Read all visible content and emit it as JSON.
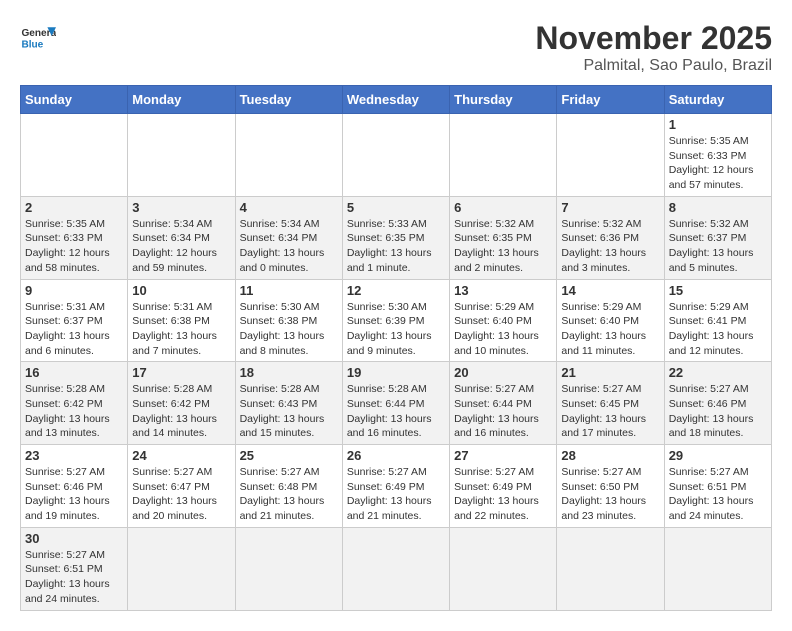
{
  "header": {
    "logo_general": "General",
    "logo_blue": "Blue",
    "month": "November 2025",
    "location": "Palmital, Sao Paulo, Brazil"
  },
  "days_of_week": [
    "Sunday",
    "Monday",
    "Tuesday",
    "Wednesday",
    "Thursday",
    "Friday",
    "Saturday"
  ],
  "weeks": [
    [
      {
        "day": "",
        "info": ""
      },
      {
        "day": "",
        "info": ""
      },
      {
        "day": "",
        "info": ""
      },
      {
        "day": "",
        "info": ""
      },
      {
        "day": "",
        "info": ""
      },
      {
        "day": "",
        "info": ""
      },
      {
        "day": "1",
        "info": "Sunrise: 5:35 AM\nSunset: 6:33 PM\nDaylight: 12 hours and 57 minutes."
      }
    ],
    [
      {
        "day": "2",
        "info": "Sunrise: 5:35 AM\nSunset: 6:33 PM\nDaylight: 12 hours and 58 minutes."
      },
      {
        "day": "3",
        "info": "Sunrise: 5:34 AM\nSunset: 6:34 PM\nDaylight: 12 hours and 59 minutes."
      },
      {
        "day": "4",
        "info": "Sunrise: 5:34 AM\nSunset: 6:34 PM\nDaylight: 13 hours and 0 minutes."
      },
      {
        "day": "5",
        "info": "Sunrise: 5:33 AM\nSunset: 6:35 PM\nDaylight: 13 hours and 1 minute."
      },
      {
        "day": "6",
        "info": "Sunrise: 5:32 AM\nSunset: 6:35 PM\nDaylight: 13 hours and 2 minutes."
      },
      {
        "day": "7",
        "info": "Sunrise: 5:32 AM\nSunset: 6:36 PM\nDaylight: 13 hours and 3 minutes."
      },
      {
        "day": "8",
        "info": "Sunrise: 5:32 AM\nSunset: 6:37 PM\nDaylight: 13 hours and 5 minutes."
      }
    ],
    [
      {
        "day": "9",
        "info": "Sunrise: 5:31 AM\nSunset: 6:37 PM\nDaylight: 13 hours and 6 minutes."
      },
      {
        "day": "10",
        "info": "Sunrise: 5:31 AM\nSunset: 6:38 PM\nDaylight: 13 hours and 7 minutes."
      },
      {
        "day": "11",
        "info": "Sunrise: 5:30 AM\nSunset: 6:38 PM\nDaylight: 13 hours and 8 minutes."
      },
      {
        "day": "12",
        "info": "Sunrise: 5:30 AM\nSunset: 6:39 PM\nDaylight: 13 hours and 9 minutes."
      },
      {
        "day": "13",
        "info": "Sunrise: 5:29 AM\nSunset: 6:40 PM\nDaylight: 13 hours and 10 minutes."
      },
      {
        "day": "14",
        "info": "Sunrise: 5:29 AM\nSunset: 6:40 PM\nDaylight: 13 hours and 11 minutes."
      },
      {
        "day": "15",
        "info": "Sunrise: 5:29 AM\nSunset: 6:41 PM\nDaylight: 13 hours and 12 minutes."
      }
    ],
    [
      {
        "day": "16",
        "info": "Sunrise: 5:28 AM\nSunset: 6:42 PM\nDaylight: 13 hours and 13 minutes."
      },
      {
        "day": "17",
        "info": "Sunrise: 5:28 AM\nSunset: 6:42 PM\nDaylight: 13 hours and 14 minutes."
      },
      {
        "day": "18",
        "info": "Sunrise: 5:28 AM\nSunset: 6:43 PM\nDaylight: 13 hours and 15 minutes."
      },
      {
        "day": "19",
        "info": "Sunrise: 5:28 AM\nSunset: 6:44 PM\nDaylight: 13 hours and 16 minutes."
      },
      {
        "day": "20",
        "info": "Sunrise: 5:27 AM\nSunset: 6:44 PM\nDaylight: 13 hours and 16 minutes."
      },
      {
        "day": "21",
        "info": "Sunrise: 5:27 AM\nSunset: 6:45 PM\nDaylight: 13 hours and 17 minutes."
      },
      {
        "day": "22",
        "info": "Sunrise: 5:27 AM\nSunset: 6:46 PM\nDaylight: 13 hours and 18 minutes."
      }
    ],
    [
      {
        "day": "23",
        "info": "Sunrise: 5:27 AM\nSunset: 6:46 PM\nDaylight: 13 hours and 19 minutes."
      },
      {
        "day": "24",
        "info": "Sunrise: 5:27 AM\nSunset: 6:47 PM\nDaylight: 13 hours and 20 minutes."
      },
      {
        "day": "25",
        "info": "Sunrise: 5:27 AM\nSunset: 6:48 PM\nDaylight: 13 hours and 21 minutes."
      },
      {
        "day": "26",
        "info": "Sunrise: 5:27 AM\nSunset: 6:49 PM\nDaylight: 13 hours and 21 minutes."
      },
      {
        "day": "27",
        "info": "Sunrise: 5:27 AM\nSunset: 6:49 PM\nDaylight: 13 hours and 22 minutes."
      },
      {
        "day": "28",
        "info": "Sunrise: 5:27 AM\nSunset: 6:50 PM\nDaylight: 13 hours and 23 minutes."
      },
      {
        "day": "29",
        "info": "Sunrise: 5:27 AM\nSunset: 6:51 PM\nDaylight: 13 hours and 24 minutes."
      }
    ],
    [
      {
        "day": "30",
        "info": "Sunrise: 5:27 AM\nSunset: 6:51 PM\nDaylight: 13 hours and 24 minutes."
      },
      {
        "day": "",
        "info": ""
      },
      {
        "day": "",
        "info": ""
      },
      {
        "day": "",
        "info": ""
      },
      {
        "day": "",
        "info": ""
      },
      {
        "day": "",
        "info": ""
      },
      {
        "day": "",
        "info": ""
      }
    ]
  ]
}
